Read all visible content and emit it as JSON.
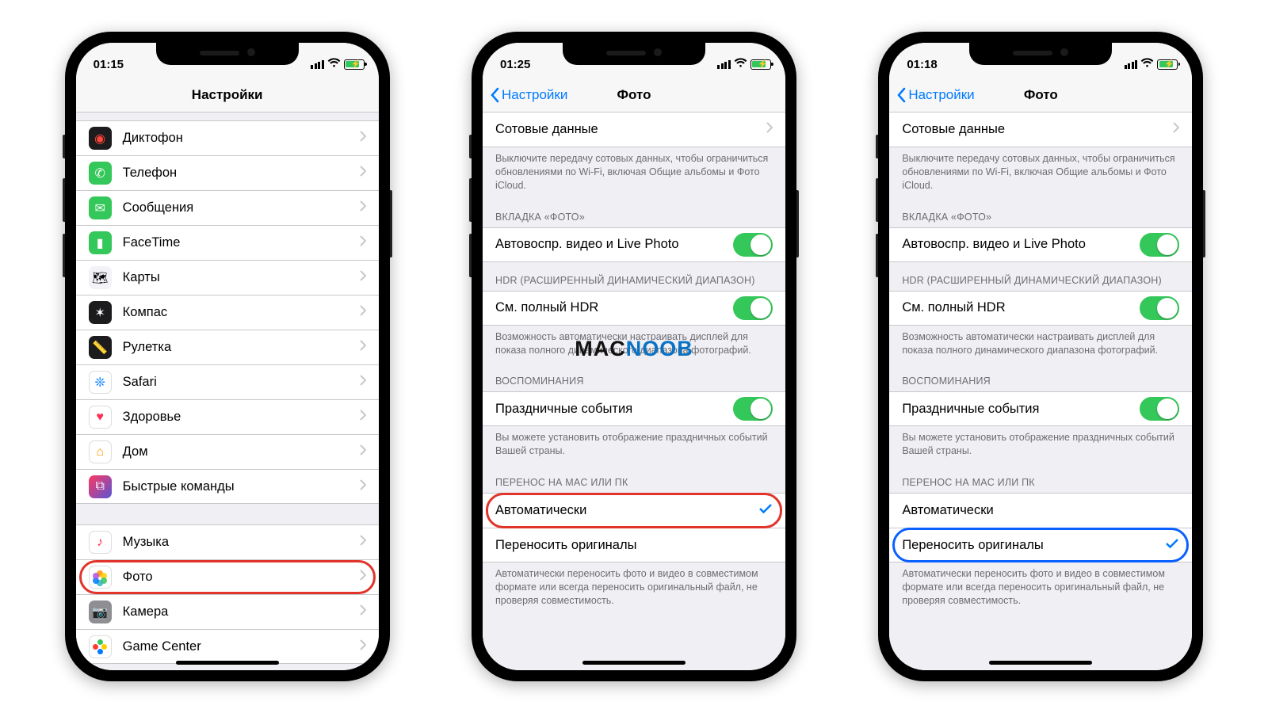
{
  "watermark": {
    "part1": "MAC",
    "part2": "NOOB"
  },
  "highlight_colors": {
    "red": "#e1332a",
    "blue": "#0a60ff"
  },
  "phone1": {
    "status_time": "01:15",
    "nav_title": "Настройки",
    "items_a": [
      {
        "label": "Диктофон",
        "icon": "dictation-icon"
      },
      {
        "label": "Телефон",
        "icon": "phone-icon"
      },
      {
        "label": "Сообщения",
        "icon": "messages-icon"
      },
      {
        "label": "FaceTime",
        "icon": "facetime-icon"
      },
      {
        "label": "Карты",
        "icon": "maps-icon"
      },
      {
        "label": "Компас",
        "icon": "compass-icon"
      },
      {
        "label": "Рулетка",
        "icon": "measure-icon"
      },
      {
        "label": "Safari",
        "icon": "safari-icon"
      },
      {
        "label": "Здоровье",
        "icon": "health-icon"
      },
      {
        "label": "Дом",
        "icon": "home-icon"
      },
      {
        "label": "Быстрые команды",
        "icon": "shortcuts-icon"
      }
    ],
    "items_b": [
      {
        "label": "Музыка",
        "icon": "music-icon"
      },
      {
        "label": "Фото",
        "icon": "photos-icon",
        "highlighted": true
      },
      {
        "label": "Камера",
        "icon": "camera-icon"
      },
      {
        "label": "Game Center",
        "icon": "gamecenter-icon"
      }
    ]
  },
  "phone2": {
    "status_time": "01:25",
    "nav_back": "Настройки",
    "nav_title": "Фото",
    "cell_cellular": "Сотовые данные",
    "footer_cellular": "Выключите передачу сотовых данных, чтобы ограничиться обновлениями по Wi-Fi, включая Общие альбомы и Фото iCloud.",
    "header_tab": "ВКЛАДКА «ФОТО»",
    "cell_autoplay": "Автовоспр. видео и Live Photo",
    "header_hdr": "HDR (РАСШИРЕННЫЙ ДИНАМИЧЕСКИЙ ДИАПАЗОН)",
    "cell_hdr": "См. полный HDR",
    "footer_hdr": "Возможность автоматически настраивать дисплей для показа полного динамического диапазона фотографий.",
    "header_memories": "ВОСПОМИНАНИЯ",
    "cell_holidays": "Праздничные события",
    "footer_holidays": "Вы можете установить отображение праздничных событий Вашей страны.",
    "header_transfer": "ПЕРЕНОС НА MAC ИЛИ ПК",
    "cell_auto": "Автоматически",
    "cell_orig": "Переносить оригиналы",
    "footer_transfer": "Автоматически переносить фото и видео в совместимом формате или всегда переносить оригинальный файл, не проверяя совместимость.",
    "selected": "auto"
  },
  "phone3": {
    "status_time": "01:18",
    "nav_back": "Настройки",
    "nav_title": "Фото",
    "selected": "orig"
  }
}
